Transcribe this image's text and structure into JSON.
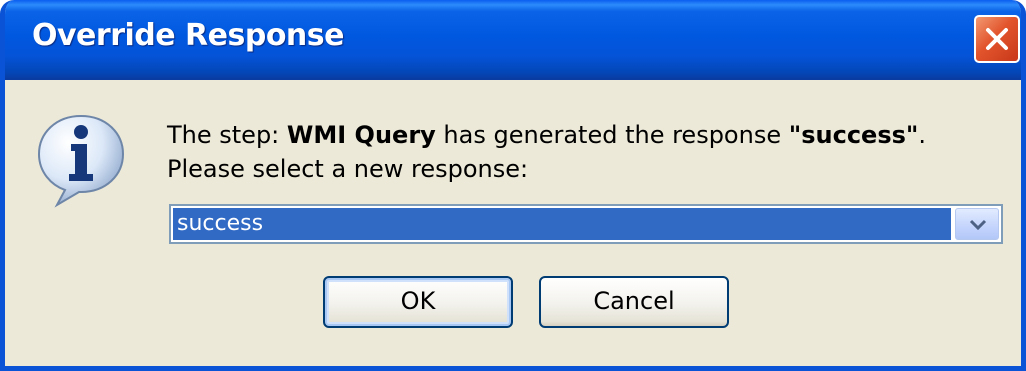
{
  "dialog": {
    "title": "Override Response",
    "close_icon": "close-icon"
  },
  "message": {
    "line1_prefix": "The step: ",
    "step_name": "WMI Query",
    "line1_middle": " has generated the response ",
    "response": "\"success\"",
    "line1_suffix": ".",
    "line2": "Please select a new response:"
  },
  "response_select": {
    "selected_value": "success"
  },
  "buttons": {
    "ok_label": "OK",
    "cancel_label": "Cancel"
  },
  "icons": {
    "info": "info-icon",
    "dropdown": "chevron-down-icon"
  },
  "colors": {
    "titlebar": "#0058e0",
    "dialog_background": "#ece9d8",
    "selection": "#316ac5",
    "close_button": "#e2542c"
  }
}
